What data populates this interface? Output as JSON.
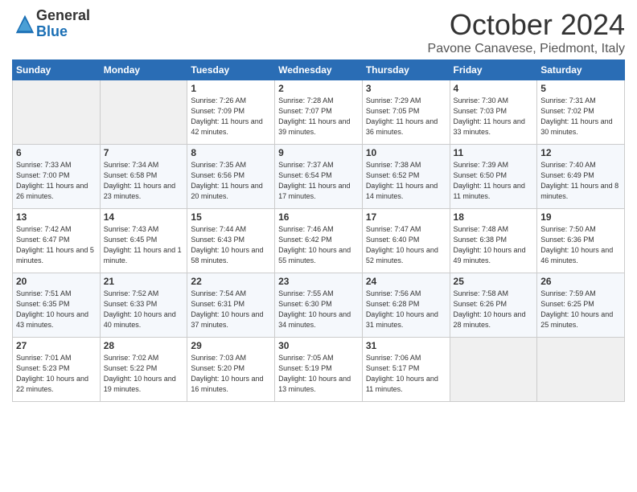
{
  "header": {
    "logo_general": "General",
    "logo_blue": "Blue",
    "month_title": "October 2024",
    "location": "Pavone Canavese, Piedmont, Italy"
  },
  "weekdays": [
    "Sunday",
    "Monday",
    "Tuesday",
    "Wednesday",
    "Thursday",
    "Friday",
    "Saturday"
  ],
  "weeks": [
    [
      {
        "day": "",
        "empty": true
      },
      {
        "day": "",
        "empty": true
      },
      {
        "day": "1",
        "sunrise": "7:26 AM",
        "sunset": "7:09 PM",
        "daylight": "11 hours and 42 minutes."
      },
      {
        "day": "2",
        "sunrise": "7:28 AM",
        "sunset": "7:07 PM",
        "daylight": "11 hours and 39 minutes."
      },
      {
        "day": "3",
        "sunrise": "7:29 AM",
        "sunset": "7:05 PM",
        "daylight": "11 hours and 36 minutes."
      },
      {
        "day": "4",
        "sunrise": "7:30 AM",
        "sunset": "7:03 PM",
        "daylight": "11 hours and 33 minutes."
      },
      {
        "day": "5",
        "sunrise": "7:31 AM",
        "sunset": "7:02 PM",
        "daylight": "11 hours and 30 minutes."
      }
    ],
    [
      {
        "day": "6",
        "sunrise": "7:33 AM",
        "sunset": "7:00 PM",
        "daylight": "11 hours and 26 minutes."
      },
      {
        "day": "7",
        "sunrise": "7:34 AM",
        "sunset": "6:58 PM",
        "daylight": "11 hours and 23 minutes."
      },
      {
        "day": "8",
        "sunrise": "7:35 AM",
        "sunset": "6:56 PM",
        "daylight": "11 hours and 20 minutes."
      },
      {
        "day": "9",
        "sunrise": "7:37 AM",
        "sunset": "6:54 PM",
        "daylight": "11 hours and 17 minutes."
      },
      {
        "day": "10",
        "sunrise": "7:38 AM",
        "sunset": "6:52 PM",
        "daylight": "11 hours and 14 minutes."
      },
      {
        "day": "11",
        "sunrise": "7:39 AM",
        "sunset": "6:50 PM",
        "daylight": "11 hours and 11 minutes."
      },
      {
        "day": "12",
        "sunrise": "7:40 AM",
        "sunset": "6:49 PM",
        "daylight": "11 hours and 8 minutes."
      }
    ],
    [
      {
        "day": "13",
        "sunrise": "7:42 AM",
        "sunset": "6:47 PM",
        "daylight": "11 hours and 5 minutes."
      },
      {
        "day": "14",
        "sunrise": "7:43 AM",
        "sunset": "6:45 PM",
        "daylight": "11 hours and 1 minute."
      },
      {
        "day": "15",
        "sunrise": "7:44 AM",
        "sunset": "6:43 PM",
        "daylight": "10 hours and 58 minutes."
      },
      {
        "day": "16",
        "sunrise": "7:46 AM",
        "sunset": "6:42 PM",
        "daylight": "10 hours and 55 minutes."
      },
      {
        "day": "17",
        "sunrise": "7:47 AM",
        "sunset": "6:40 PM",
        "daylight": "10 hours and 52 minutes."
      },
      {
        "day": "18",
        "sunrise": "7:48 AM",
        "sunset": "6:38 PM",
        "daylight": "10 hours and 49 minutes."
      },
      {
        "day": "19",
        "sunrise": "7:50 AM",
        "sunset": "6:36 PM",
        "daylight": "10 hours and 46 minutes."
      }
    ],
    [
      {
        "day": "20",
        "sunrise": "7:51 AM",
        "sunset": "6:35 PM",
        "daylight": "10 hours and 43 minutes."
      },
      {
        "day": "21",
        "sunrise": "7:52 AM",
        "sunset": "6:33 PM",
        "daylight": "10 hours and 40 minutes."
      },
      {
        "day": "22",
        "sunrise": "7:54 AM",
        "sunset": "6:31 PM",
        "daylight": "10 hours and 37 minutes."
      },
      {
        "day": "23",
        "sunrise": "7:55 AM",
        "sunset": "6:30 PM",
        "daylight": "10 hours and 34 minutes."
      },
      {
        "day": "24",
        "sunrise": "7:56 AM",
        "sunset": "6:28 PM",
        "daylight": "10 hours and 31 minutes."
      },
      {
        "day": "25",
        "sunrise": "7:58 AM",
        "sunset": "6:26 PM",
        "daylight": "10 hours and 28 minutes."
      },
      {
        "day": "26",
        "sunrise": "7:59 AM",
        "sunset": "6:25 PM",
        "daylight": "10 hours and 25 minutes."
      }
    ],
    [
      {
        "day": "27",
        "sunrise": "7:01 AM",
        "sunset": "5:23 PM",
        "daylight": "10 hours and 22 minutes."
      },
      {
        "day": "28",
        "sunrise": "7:02 AM",
        "sunset": "5:22 PM",
        "daylight": "10 hours and 19 minutes."
      },
      {
        "day": "29",
        "sunrise": "7:03 AM",
        "sunset": "5:20 PM",
        "daylight": "10 hours and 16 minutes."
      },
      {
        "day": "30",
        "sunrise": "7:05 AM",
        "sunset": "5:19 PM",
        "daylight": "10 hours and 13 minutes."
      },
      {
        "day": "31",
        "sunrise": "7:06 AM",
        "sunset": "5:17 PM",
        "daylight": "10 hours and 11 minutes."
      },
      {
        "day": "",
        "empty": true
      },
      {
        "day": "",
        "empty": true
      }
    ]
  ]
}
